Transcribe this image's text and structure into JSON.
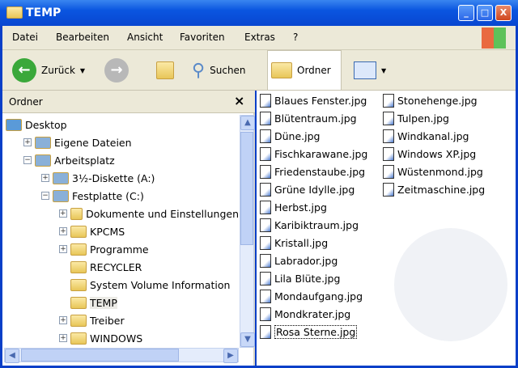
{
  "window": {
    "title": "TEMP",
    "minimize": "_",
    "maximize": "□",
    "close": "X"
  },
  "menu": [
    "Datei",
    "Bearbeiten",
    "Ansicht",
    "Favoriten",
    "Extras",
    "?"
  ],
  "toolbar": {
    "back": "Zurück",
    "search": "Suchen",
    "folders": "Ordner"
  },
  "pane": {
    "title": "Ordner",
    "close": "×"
  },
  "tree": [
    {
      "label": "Desktop",
      "level": 0,
      "toggle": ""
    },
    {
      "label": "Eigene Dateien",
      "level": 1,
      "toggle": "+"
    },
    {
      "label": "Arbeitsplatz",
      "level": 1,
      "toggle": "−"
    },
    {
      "label": "3½-Diskette (A:)",
      "level": 2,
      "toggle": "+"
    },
    {
      "label": "Festplatte (C:)",
      "level": 2,
      "toggle": "−"
    },
    {
      "label": "Dokumente und Einstellungen",
      "level": 3,
      "toggle": "+"
    },
    {
      "label": "KPCMS",
      "level": 3,
      "toggle": "+"
    },
    {
      "label": "Programme",
      "level": 3,
      "toggle": "+"
    },
    {
      "label": "RECYCLER",
      "level": 3,
      "toggle": ""
    },
    {
      "label": "System Volume Information",
      "level": 3,
      "toggle": ""
    },
    {
      "label": "TEMP",
      "level": 3,
      "toggle": "",
      "selected": true
    },
    {
      "label": "Treiber",
      "level": 3,
      "toggle": "+"
    },
    {
      "label": "WINDOWS",
      "level": 3,
      "toggle": "+"
    }
  ],
  "files_col1": [
    "Blaues Fenster.jpg",
    "Blütentraum.jpg",
    "Düne.jpg",
    "Fischkarawane.jpg",
    "Friedenstaube.jpg",
    "Grüne Idylle.jpg",
    "Herbst.jpg",
    "Karibiktraum.jpg",
    "Kristall.jpg",
    "Labrador.jpg",
    "Lila Blüte.jpg",
    "Mondaufgang.jpg",
    "Mondkrater.jpg",
    "Rosa Sterne.jpg"
  ],
  "files_col2": [
    "Stonehenge.jpg",
    "Tulpen.jpg",
    "Windkanal.jpg",
    "Windows XP.jpg",
    "Wüstenmond.jpg",
    "Zeitmaschine.jpg"
  ],
  "selected_file": "Rosa Sterne.jpg"
}
